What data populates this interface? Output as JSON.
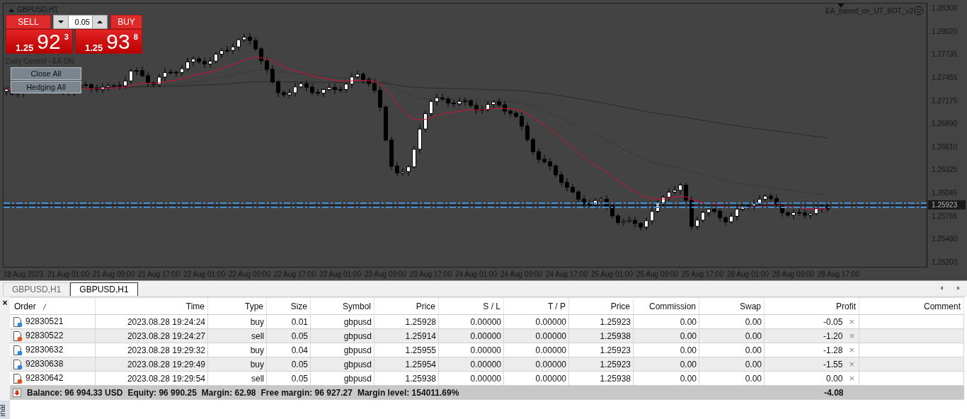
{
  "chart": {
    "title": "GBPUSD,H1",
    "expert": "EA_based_on_UT_BOT_v2",
    "one_click": {
      "sell_label": "SELL",
      "buy_label": "BUY",
      "volume": "0.05",
      "bid": {
        "big": "1.25",
        "main": "92",
        "small": "3"
      },
      "ask": {
        "big": "1.25",
        "main": "93",
        "small": "8"
      }
    },
    "status_text": "Daily Control - EA ON",
    "buttons": [
      "Close All",
      "Hedging All"
    ],
    "price_axis": [
      "1.28300",
      "1.28020",
      "1.27735",
      "1.27455",
      "1.27175",
      "1.26890",
      "1.26610",
      "1.26325",
      "1.26045",
      "1.25765",
      "1.25480",
      "1.25200"
    ],
    "current_price": "1.25923",
    "time_axis": [
      "18 Aug 2023",
      "21 Aug 01:00",
      "21 Aug 09:00",
      "21 Aug 17:00",
      "22 Aug 01:00",
      "22 Aug 09:00",
      "22 Aug 17:00",
      "23 Aug 01:00",
      "23 Aug 09:00",
      "23 Aug 17:00",
      "24 Aug 01:00",
      "24 Aug 09:00",
      "24 Aug 17:00",
      "25 Aug 01:00",
      "25 Aug 09:00",
      "25 Aug 17:00",
      "28 Aug 01:00",
      "28 Aug 09:00",
      "28 Aug 17:00"
    ]
  },
  "chart_tabs": [
    {
      "label": "GBPUSD,H1",
      "selected": false
    },
    {
      "label": "GBPUSD,H1",
      "selected": true
    }
  ],
  "terminal": {
    "close_glyph": "×",
    "side_label": "inal",
    "columns": [
      {
        "label": "Order",
        "sorted": true
      },
      {
        "label": "Time",
        "sorted": false
      },
      {
        "label": "Type",
        "sorted": false
      },
      {
        "label": "Size",
        "sorted": false
      },
      {
        "label": "Symbol",
        "sorted": false
      },
      {
        "label": "Price",
        "sorted": false
      },
      {
        "label": "S / L",
        "sorted": false
      },
      {
        "label": "T / P",
        "sorted": false
      },
      {
        "label": "Price",
        "sorted": false
      },
      {
        "label": "Commission",
        "sorted": false
      },
      {
        "label": "Swap",
        "sorted": false
      },
      {
        "label": "Profit",
        "sorted": false
      },
      {
        "label": "Comment",
        "sorted": false
      }
    ],
    "rows": [
      {
        "kind": "buy",
        "cells": [
          "92830521",
          "2023.08.28 19:24:24",
          "buy",
          "0.01",
          "gbpusd",
          "1.25928",
          "0.00000",
          "0.00000",
          "1.25923",
          "0.00",
          "0.00",
          "-0.05"
        ],
        "close": "×"
      },
      {
        "kind": "sell",
        "cells": [
          "92830522",
          "2023.08.28 19:24:27",
          "sell",
          "0.05",
          "gbpusd",
          "1.25914",
          "0.00000",
          "0.00000",
          "1.25938",
          "0.00",
          "0.00",
          "-1.20"
        ],
        "close": "×"
      },
      {
        "kind": "buy",
        "cells": [
          "92830632",
          "2023.08.28 19:29:32",
          "buy",
          "0.04",
          "gbpusd",
          "1.25955",
          "0.00000",
          "0.00000",
          "1.25923",
          "0.00",
          "0.00",
          "-1.28"
        ],
        "close": "×"
      },
      {
        "kind": "buy",
        "cells": [
          "92830638",
          "2023.08.28 19:29:49",
          "buy",
          "0.05",
          "gbpusd",
          "1.25954",
          "0.00000",
          "0.00000",
          "1.25923",
          "0.00",
          "0.00",
          "-1.55"
        ],
        "close": "×"
      },
      {
        "kind": "sell",
        "cells": [
          "92830642",
          "2023.08.28 19:29:54",
          "sell",
          "0.05",
          "gbpusd",
          "1.25938",
          "0.00000",
          "0.00000",
          "1.25938",
          "0.00",
          "0.00",
          "0.00"
        ],
        "close": "×"
      }
    ],
    "summary": {
      "items": [
        "Balance: 96 994.33 USD",
        "Equity: 96 990.25",
        "Margin: 62.98",
        "Free margin: 96 927.27",
        "Margin level: 154011.69%"
      ],
      "profit": "-4.08"
    }
  }
}
